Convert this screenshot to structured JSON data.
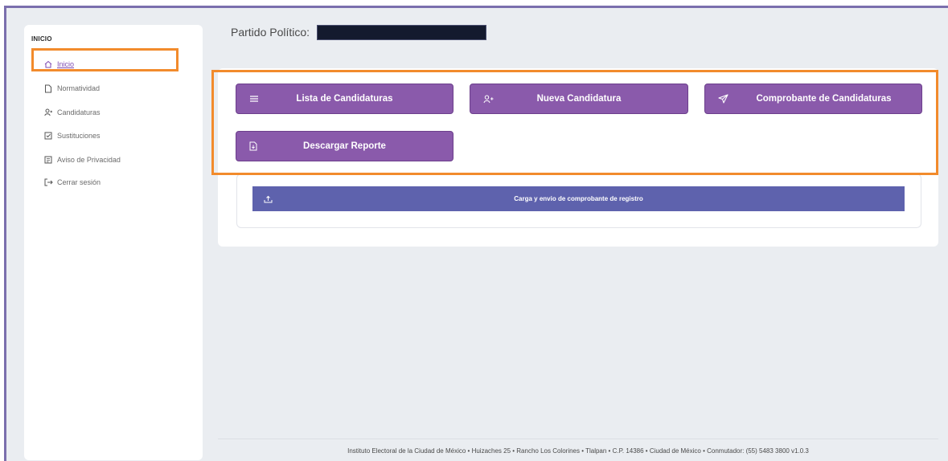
{
  "sidebar": {
    "title": "INICIO",
    "items": [
      {
        "label": "Inicio",
        "icon": "home-icon"
      },
      {
        "label": "Normatividad",
        "icon": "document-icon"
      },
      {
        "label": "Candidaturas",
        "icon": "users-icon"
      },
      {
        "label": "Sustituciones",
        "icon": "checkbox-icon"
      },
      {
        "label": "Aviso de Privacidad",
        "icon": "notice-icon"
      },
      {
        "label": "Cerrar sesión",
        "icon": "logout-icon"
      }
    ]
  },
  "header": {
    "party_label": "Partido Político:"
  },
  "actions": {
    "list_label": "Lista de Candidaturas",
    "new_label": "Nueva Candidatura",
    "receipt_label": "Comprobante de Candidaturas",
    "report_label": "Descargar Reporte",
    "upload_label": "Carga y envio de comprobante de registro"
  },
  "footer": {
    "text": "Instituto Electoral de la Ciudad de México • Huizaches 25 • Rancho Los Colorines • Tlalpan • C.P. 14386 • Ciudad de México • Conmutador: (55) 5483 3800 v1.0.3"
  },
  "colors": {
    "accent_purple": "#8a5aab",
    "upload_blue": "#5e62ad",
    "highlight_orange": "#f28b2c",
    "frame_border": "#7b6fad"
  }
}
